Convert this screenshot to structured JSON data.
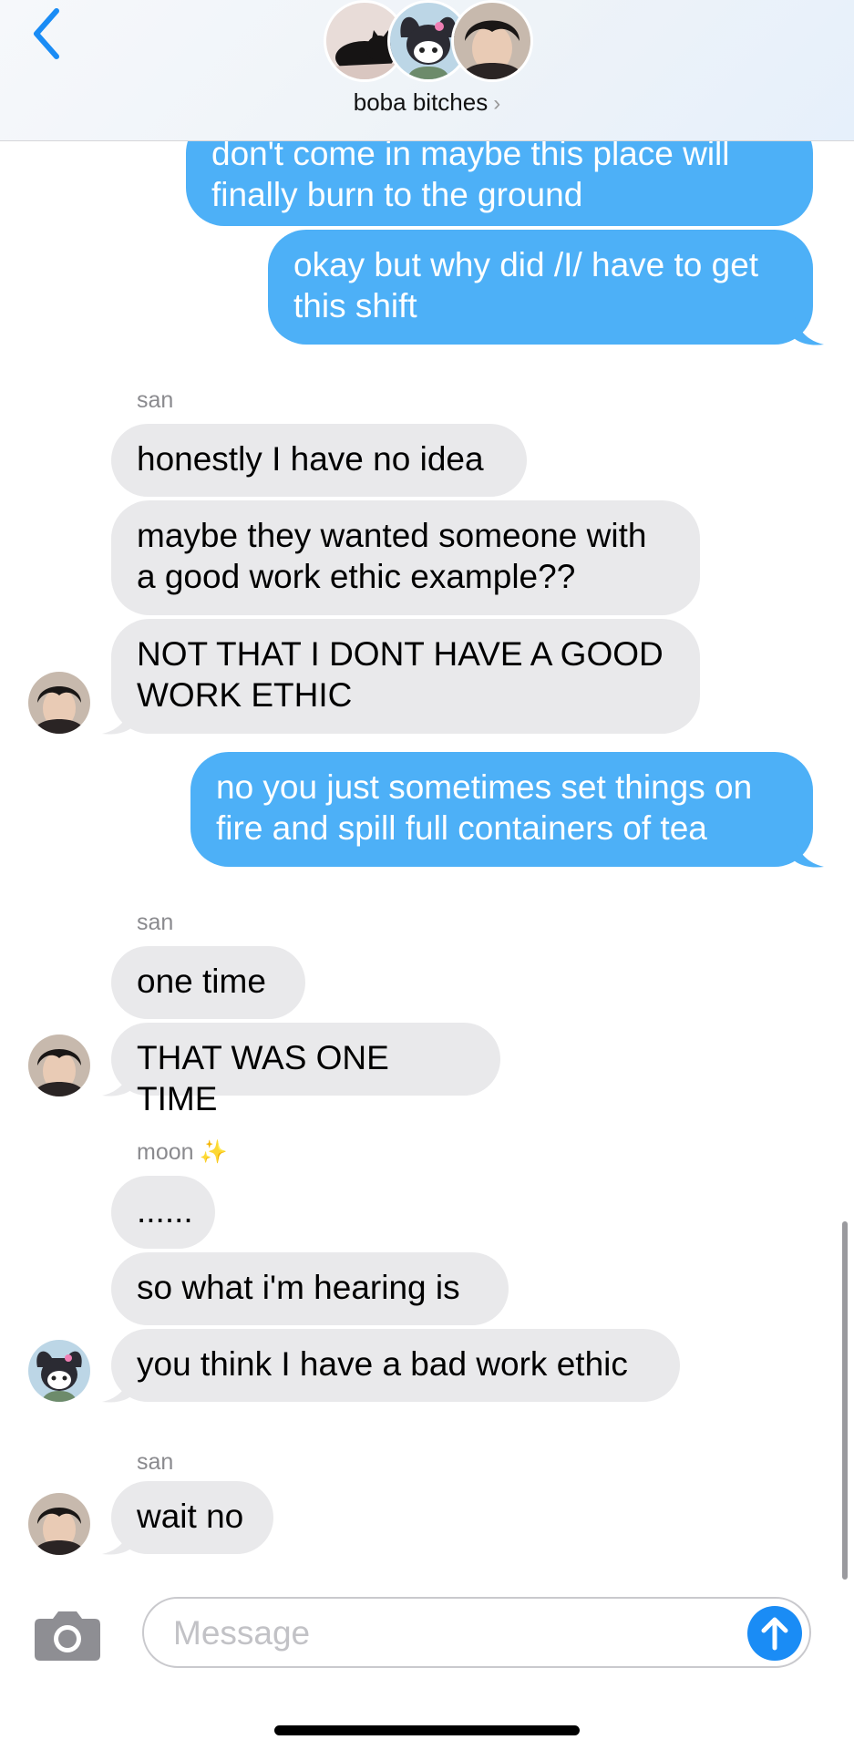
{
  "header": {
    "group_name": "boba bitches",
    "chevron": "›",
    "avatars": [
      "cat-avatar",
      "kuromi-avatar",
      "person-avatar"
    ]
  },
  "messages": [
    {
      "type": "out",
      "text": "don't come in maybe this place will finally burn to the ground"
    },
    {
      "type": "out",
      "text": "okay but why did /I/ have to get this shift"
    },
    {
      "type": "sender",
      "text": "san"
    },
    {
      "type": "in",
      "text": "honestly I have no idea"
    },
    {
      "type": "in",
      "text": "maybe they wanted someone with a good work ethic example??"
    },
    {
      "type": "in",
      "text": "NOT THAT I DONT HAVE A GOOD WORK ETHIC"
    },
    {
      "type": "out",
      "text": "no you just sometimes set things on fire and spill full containers of tea"
    },
    {
      "type": "sender",
      "text": "san"
    },
    {
      "type": "in",
      "text": "one time"
    },
    {
      "type": "in",
      "text": "THAT WAS ONE TIME"
    },
    {
      "type": "sender",
      "text": "moon",
      "emoji": "✨"
    },
    {
      "type": "in",
      "text": "......"
    },
    {
      "type": "in",
      "text": "so what i'm hearing is"
    },
    {
      "type": "in",
      "text": "you think I have a bad work ethic"
    },
    {
      "type": "sender",
      "text": "san"
    },
    {
      "type": "in",
      "text": "wait no"
    }
  ],
  "input": {
    "placeholder": "Message"
  },
  "colors": {
    "accent": "#1a8cf5",
    "outgoing": "#4db0f7",
    "incoming": "#e9e9eb"
  }
}
